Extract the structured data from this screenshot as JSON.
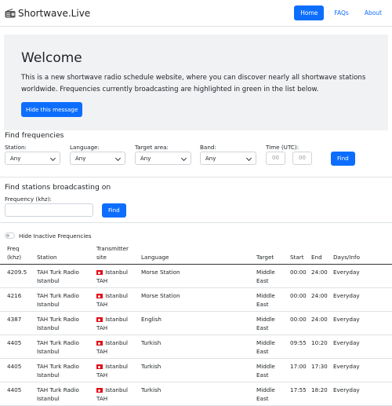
{
  "navbar": {
    "brand": "Shortwave.Live",
    "links": [
      "Home",
      "FAQs",
      "About"
    ]
  },
  "welcome": {
    "title": "Welcome",
    "text": "This is a new shortwave radio schedule website, where you can discover nearly all shortwave stations worldwide. Frequencies currently broadcasting are highlighted in green in the list below.",
    "hide_button": "Hide this message"
  },
  "find_frequencies": {
    "title": "Find frequencies",
    "station_label": "Station:",
    "station_value": "Any",
    "language_label": "Language:",
    "language_value": "Any",
    "target_label": "Target area:",
    "target_value": "Any",
    "band_label": "Band:",
    "band_value": "Any",
    "time_label": "Time (UTC):",
    "time_from_placeholder": "00",
    "time_to_placeholder": "00",
    "find_button": "Find"
  },
  "find_stations": {
    "title": "Find stations broadcasting on",
    "freq_label": "Frequency (khz):",
    "freq_value": "",
    "find_button": "Find"
  },
  "hide_inactive_label": "Hide Inactive Frequencies",
  "table": {
    "headers": {
      "freq": "Freq",
      "freq_unit": "(khz)",
      "station": "Station",
      "transmitter": "Transmitter",
      "transmitter2": "site",
      "language": "Language",
      "target": "Target",
      "start": "Start",
      "end": "End",
      "days": "Days/Info"
    },
    "rows": [
      {
        "freq": "4209.5",
        "station1": "TAH Turk Radio",
        "station2": "Istanbul",
        "site1": "Istanbul",
        "site2": "TAH",
        "language": "Morse Station",
        "target1": "Middle",
        "target2": "East",
        "start": "00:00",
        "end": "24:00",
        "days": "Everyday"
      },
      {
        "freq": "4216",
        "station1": "TAH Turk Radio",
        "station2": "Istanbul",
        "site1": "Istanbul",
        "site2": "TAH",
        "language": "Morse Station",
        "target1": "Middle",
        "target2": "East",
        "start": "00:00",
        "end": "24:00",
        "days": "Everyday"
      },
      {
        "freq": "4387",
        "station1": "TAH Turk Radio",
        "station2": "Istanbul",
        "site1": "Istanbul",
        "site2": "TAH",
        "language": "English",
        "target1": "Middle",
        "target2": "East",
        "start": "00:00",
        "end": "24:00",
        "days": "Everyday"
      },
      {
        "freq": "4405",
        "station1": "TAH Turk Radio",
        "station2": "Istanbul",
        "site1": "Istanbul",
        "site2": "TAH",
        "language": "Turkish",
        "target1": "Middle",
        "target2": "East",
        "start": "09:55",
        "end": "10:20",
        "days": "Everyday"
      },
      {
        "freq": "4405",
        "station1": "TAH Turk Radio",
        "station2": "Istanbul",
        "site1": "Istanbul",
        "site2": "TAH",
        "language": "Turkish",
        "target1": "Middle",
        "target2": "East",
        "start": "17:00",
        "end": "17:30",
        "days": "Everyday"
      },
      {
        "freq": "4405",
        "station1": "TAH Turk Radio",
        "station2": "Istanbul",
        "site1": "Istanbul",
        "site2": "TAH",
        "language": "Turkish",
        "target1": "Middle",
        "target2": "East",
        "start": "17:55",
        "end": "18:20",
        "days": "Everyday"
      }
    ]
  },
  "colors": {
    "primary": "#0d6efd",
    "jumbotron_bg": "#f1f2f4",
    "flag_red": "#e30a17"
  },
  "icons": {
    "brand": "radio-icon",
    "flag": "turkey-flag-icon"
  }
}
